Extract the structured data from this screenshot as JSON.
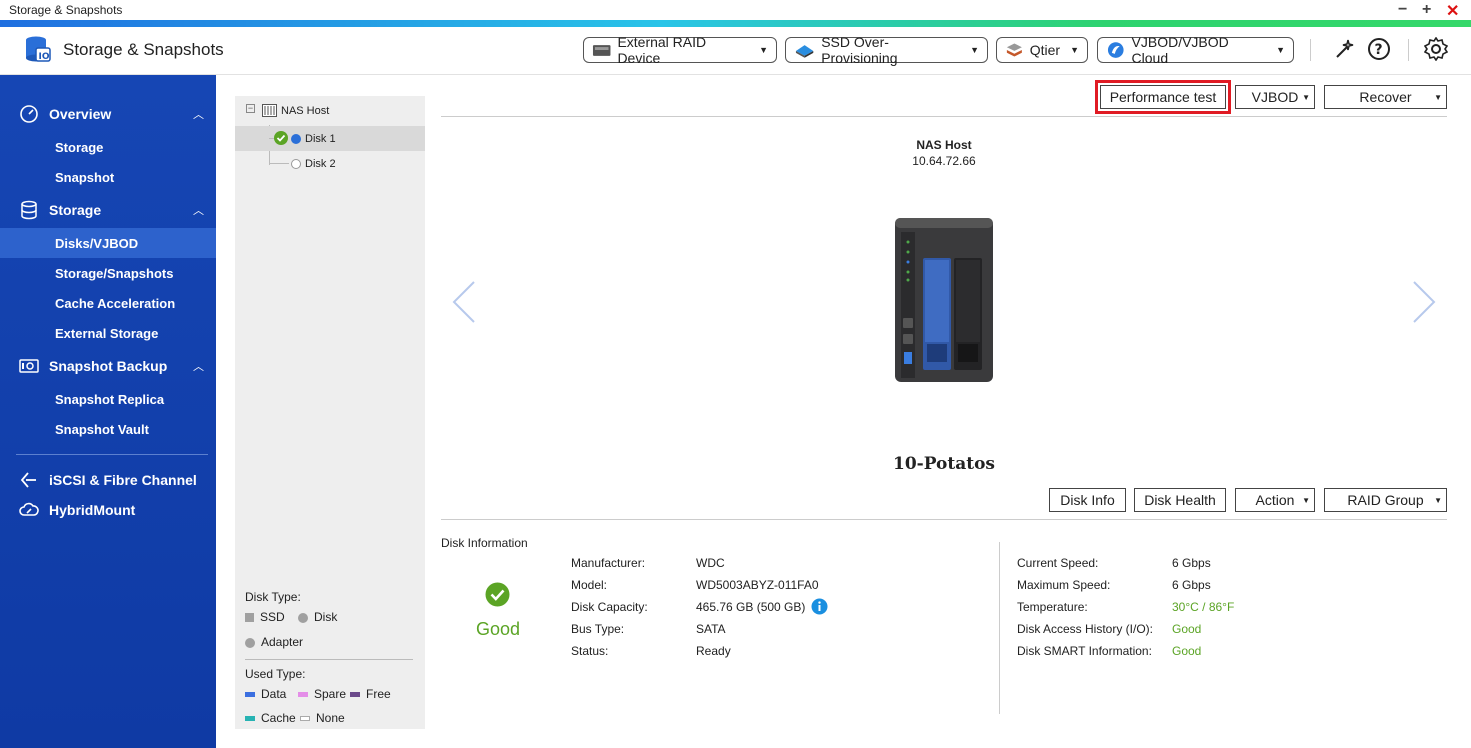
{
  "window": {
    "title": "Storage & Snapshots"
  },
  "header": {
    "app_title": "Storage & Snapshots",
    "buttons": [
      {
        "label": "External RAID Device",
        "icon": "external-raid-icon"
      },
      {
        "label": "SSD Over-Provisioning",
        "icon": "ssd-icon"
      },
      {
        "label": "Qtier",
        "icon": "qtier-icon"
      },
      {
        "label": "VJBOD/VJBOD Cloud",
        "icon": "vjbod-cloud-icon"
      }
    ]
  },
  "sidebar": {
    "sections": [
      {
        "label": "Overview",
        "items": [
          "Storage",
          "Snapshot"
        ]
      },
      {
        "label": "Storage",
        "items": [
          "Disks/VJBOD",
          "Storage/Snapshots",
          "Cache Acceleration",
          "External Storage"
        ]
      },
      {
        "label": "Snapshot Backup",
        "items": [
          "Snapshot Replica",
          "Snapshot Vault"
        ]
      },
      {
        "label": "iSCSI & Fibre Channel",
        "items": []
      },
      {
        "label": "HybridMount",
        "items": []
      }
    ],
    "active_item": "Disks/VJBOD"
  },
  "tree": {
    "root": "NAS Host",
    "disks": [
      "Disk 1",
      "Disk 2"
    ],
    "selected": "Disk 1"
  },
  "legend": {
    "disk_type_title": "Disk Type:",
    "disk_types": [
      "SSD",
      "Disk",
      "Adapter"
    ],
    "used_type_title": "Used Type:",
    "used_types": [
      "Data",
      "Spare",
      "Free",
      "Cache",
      "None"
    ]
  },
  "toolbar_top": {
    "performance_test": "Performance test",
    "vjbod": "VJBOD",
    "recover": "Recover"
  },
  "device": {
    "name": "NAS Host",
    "ip": "10.64.72.66",
    "model": "10-Potatos"
  },
  "toolbar_bottom": {
    "disk_info": "Disk Info",
    "disk_health": "Disk Health",
    "action": "Action",
    "raid_group": "RAID Group"
  },
  "disk_information": {
    "title": "Disk Information",
    "status_label": "Good",
    "left": [
      {
        "label": "Manufacturer:",
        "value": "WDC"
      },
      {
        "label": "Model:",
        "value": "WD5003ABYZ-011FA0"
      },
      {
        "label": "Disk Capacity:",
        "value": "465.76 GB (500 GB)"
      },
      {
        "label": "Bus Type:",
        "value": "SATA"
      },
      {
        "label": "Status:",
        "value": "Ready"
      }
    ],
    "right": [
      {
        "label": "Current Speed:",
        "value": "6 Gbps"
      },
      {
        "label": "Maximum Speed:",
        "value": "6 Gbps"
      },
      {
        "label": "Temperature:",
        "value": "30°C / 86°F"
      },
      {
        "label": "Disk Access History (I/O):",
        "value": "Good"
      },
      {
        "label": "Disk SMART Information:",
        "value": "Good"
      }
    ]
  },
  "colors": {
    "sidebar": "#1646b4",
    "active_item": "#2d62cc",
    "good": "#5ba425",
    "highlight": "#e01b24"
  }
}
